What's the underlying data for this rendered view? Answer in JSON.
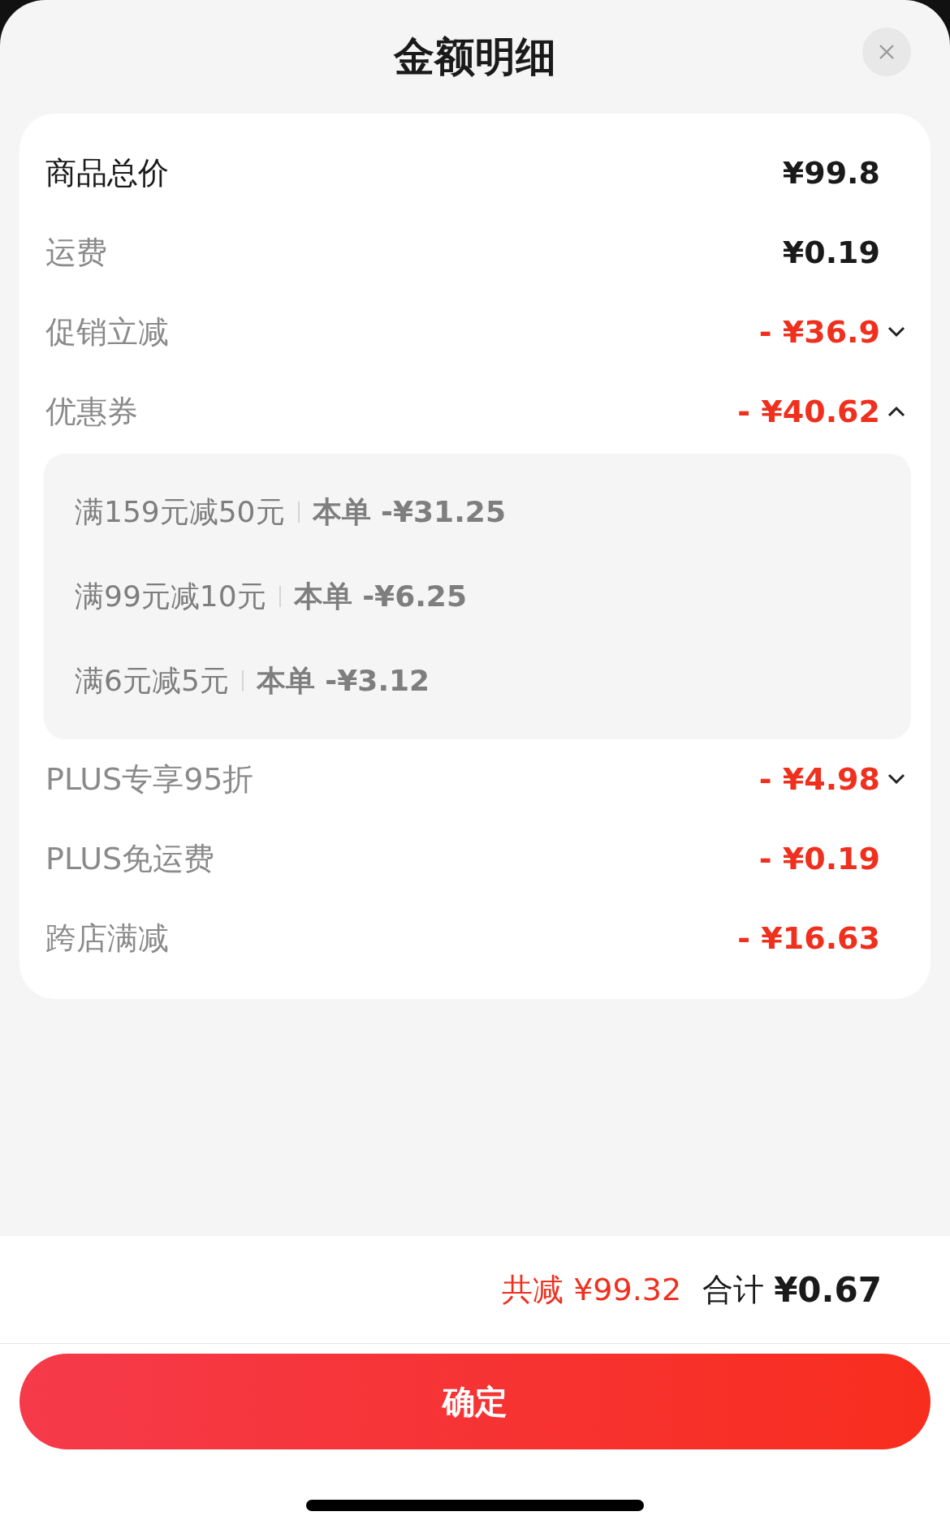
{
  "title": "金额明细",
  "rows": [
    {
      "kind": "total",
      "label": "商品总价",
      "value": "¥99.8"
    },
    {
      "kind": "fee",
      "label": "运费",
      "value": "¥0.19"
    },
    {
      "kind": "discount",
      "label": "促销立减",
      "value": "- ¥36.9",
      "expanded": false
    },
    {
      "kind": "discount",
      "label": "优惠券",
      "value": "- ¥40.62",
      "expanded": true,
      "details": [
        {
          "rule": "满159元减50元",
          "applied": "本单 -¥31.25"
        },
        {
          "rule": "满99元减10元",
          "applied": "本单 -¥6.25"
        },
        {
          "rule": "满6元减5元",
          "applied": "本单 -¥3.12"
        }
      ]
    },
    {
      "kind": "discount",
      "label": "PLUS专享95折",
      "value": "- ¥4.98",
      "expanded": false
    },
    {
      "kind": "discount",
      "label": "PLUS免运费",
      "value": "- ¥0.19"
    },
    {
      "kind": "discount",
      "label": "跨店满减",
      "value": "- ¥16.63"
    }
  ],
  "summary": {
    "saved": "共减 ¥99.32",
    "total_label": "合计",
    "total": "¥0.67"
  },
  "confirm_button": "确定"
}
